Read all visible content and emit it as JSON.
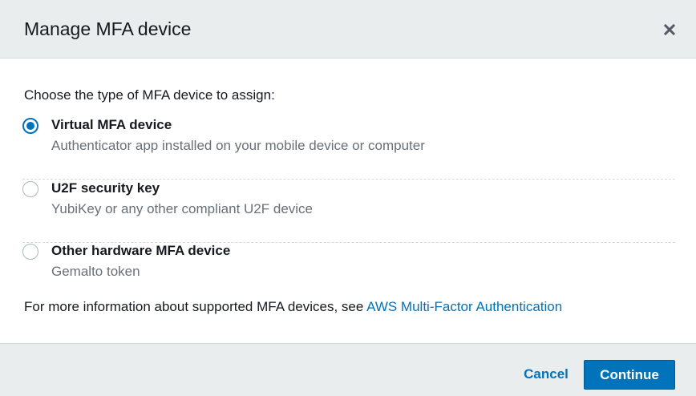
{
  "modal": {
    "title": "Manage MFA device",
    "close_icon": "close-icon"
  },
  "body": {
    "prompt": "Choose the type of MFA device to assign:",
    "options": [
      {
        "label": "Virtual MFA device",
        "description": "Authenticator app installed on your mobile device or computer",
        "selected": true
      },
      {
        "label": "U2F security key",
        "description": "YubiKey or any other compliant U2F device",
        "selected": false
      },
      {
        "label": "Other hardware MFA device",
        "description": "Gemalto token",
        "selected": false
      }
    ],
    "more_info_text": "For more information about supported MFA devices, see ",
    "more_info_link": "AWS Multi-Factor Authentication"
  },
  "footer": {
    "cancel_label": "Cancel",
    "continue_label": "Continue"
  },
  "colors": {
    "accent": "#0073bb",
    "header_bg": "#eaeded",
    "secondary_text": "#687078"
  }
}
